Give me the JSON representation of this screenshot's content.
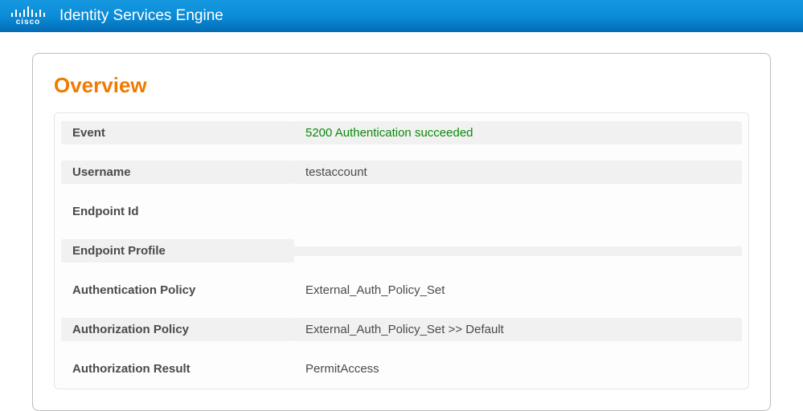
{
  "header": {
    "brand": "cisco",
    "title": "Identity Services Engine"
  },
  "panel": {
    "title": "Overview",
    "rows": [
      {
        "label": "Event",
        "value": "5200 Authentication succeeded",
        "success": true
      },
      {
        "label": "Username",
        "value": "testaccount"
      },
      {
        "label": "Endpoint Id",
        "value": ""
      },
      {
        "label": "Endpoint Profile",
        "value": ""
      },
      {
        "label": "Authentication Policy",
        "value": "External_Auth_Policy_Set"
      },
      {
        "label": "Authorization Policy",
        "value": "External_Auth_Policy_Set >> Default"
      },
      {
        "label": "Authorization Result",
        "value": "PermitAccess"
      }
    ]
  }
}
